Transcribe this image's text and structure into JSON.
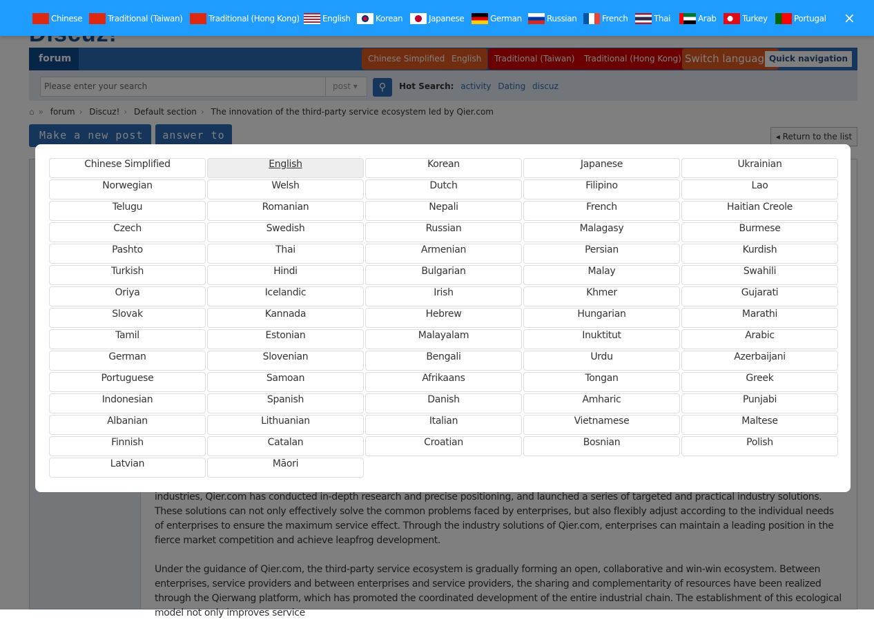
{
  "colors": {
    "topbar": "#1e9cff",
    "nav": "#2d6ab4",
    "accent": "#2d6ab4"
  },
  "topbar": {
    "languages": [
      {
        "label": "Chinese",
        "flag": "cn"
      },
      {
        "label": "Traditional (Taiwan)",
        "flag": "cn"
      },
      {
        "label": "Traditional (Hong Kong)",
        "flag": "cn"
      },
      {
        "label": "English",
        "flag": "us"
      },
      {
        "label": "Korean",
        "flag": "kr"
      },
      {
        "label": "Japanese",
        "flag": "jp"
      },
      {
        "label": "German",
        "flag": "de"
      },
      {
        "label": "Russian",
        "flag": "ru"
      },
      {
        "label": "French",
        "flag": "fr"
      },
      {
        "label": "Thai",
        "flag": "th"
      },
      {
        "label": "Arab",
        "flag": "ae"
      },
      {
        "label": "Turkey",
        "flag": "tr"
      },
      {
        "label": "Portugal",
        "flag": "pt"
      }
    ],
    "close": "×"
  },
  "site": {
    "logo": "Discuz!"
  },
  "nav": {
    "forum": "forum",
    "lang_buttons": [
      "Chinese Simplified",
      "English",
      "Traditional (Taiwan)",
      "Traditional (Hong Kong)",
      "Switch languages"
    ],
    "quick_nav": "Quick navigation"
  },
  "search": {
    "placeholder": "Please enter your search",
    "type": "post ▾",
    "hot_label": "Hot Search:",
    "hot": [
      "activity",
      "Dating",
      "discuz"
    ]
  },
  "breadcrumb": [
    "forum",
    "Discuz!",
    "Default section",
    "The innovation of the third-party service ecosystem led by Qier.com"
  ],
  "actions": {
    "new_post": "Make a new post ▾",
    "answer": "answer to",
    "return": "◂ Return to the list"
  },
  "content": {
    "paragraphs": [
      "industries, Qier.com has conducted in-depth research and precise positioning, and launched a series of targeted and practical industry solutions. These solutions can not only effectively solve the common problems faced by enterprises, but also flexibly adjust according to the individual needs of enterprises to ensure the maximum service effect. Through the industry solutions of Qier.com, enterprises can maintain a leading position in the fierce market competition and achieve leapfrog development.",
      "Under the guidance of Qier.com, the third-party service ecosystem is gradually forming an open, collaborative and win-win ecosystem. Between enterprises, service providers and between enterprises and service providers, the sharing and complementarity of resources have been realized through the Qierwang platform, which has promoted the coordinated development of the entire industrial chain. The establishment of this ecological model not only improves service"
    ]
  },
  "modal": {
    "selected": "English",
    "languages": [
      "Chinese Simplified",
      "English",
      "Korean",
      "Japanese",
      "Ukrainian",
      "Norwegian",
      "Welsh",
      "Dutch",
      "Filipino",
      "Lao",
      "Telugu",
      "Romanian",
      "Nepali",
      "French",
      "Haitian Creole",
      "Czech",
      "Swedish",
      "Russian",
      "Malagasy",
      "Burmese",
      "Pashto",
      "Thai",
      "Armenian",
      "Persian",
      "Kurdish",
      "Turkish",
      "Hindi",
      "Bulgarian",
      "Malay",
      "Swahili",
      "Oriya",
      "Icelandic",
      "Irish",
      "Khmer",
      "Gujarati",
      "Slovak",
      "Kannada",
      "Hebrew",
      "Hungarian",
      "Marathi",
      "Tamil",
      "Estonian",
      "Malayalam",
      "Inuktitut",
      "Arabic",
      "German",
      "Slovenian",
      "Bengali",
      "Urdu",
      "Azerbaijani",
      "Portuguese",
      "Samoan",
      "Afrikaans",
      "Tongan",
      "Greek",
      "Indonesian",
      "Spanish",
      "Danish",
      "Amharic",
      "Punjabi",
      "Albanian",
      "Lithuanian",
      "Italian",
      "Vietnamese",
      "Maltese",
      "Finnish",
      "Catalan",
      "Croatian",
      "Bosnian",
      "Polish",
      "Latvian",
      "Māori"
    ]
  }
}
